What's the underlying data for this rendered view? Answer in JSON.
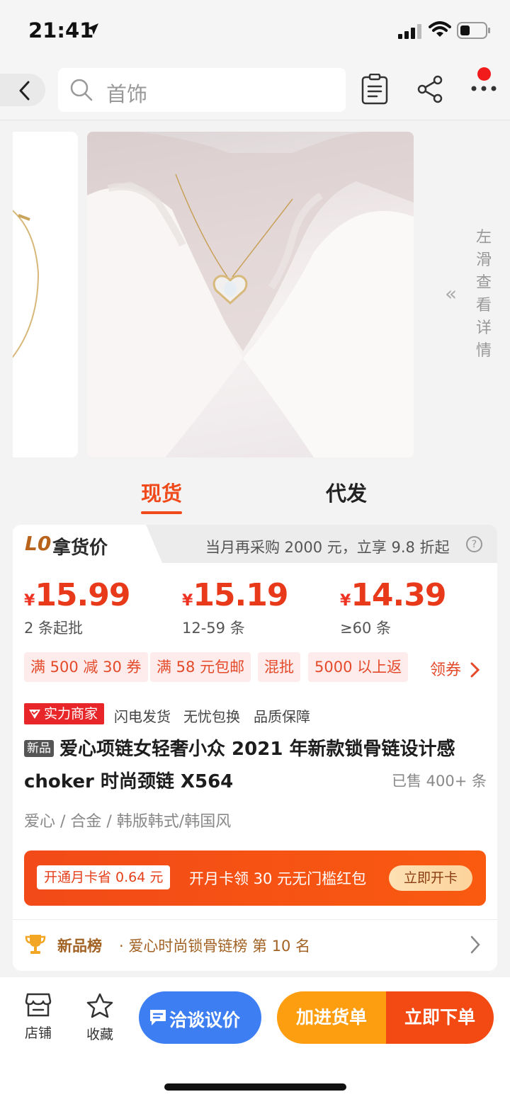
{
  "status_bar": {
    "time": "21:41"
  },
  "nav": {
    "search_placeholder": "首饰"
  },
  "gallery": {
    "slide_hint": "左滑查看详情"
  },
  "tabs": [
    {
      "label": "现货",
      "active": true
    },
    {
      "label": "代发",
      "active": false
    }
  ],
  "price_card": {
    "level_badge": "L0",
    "level_label": "拿货价",
    "promo_text": "当月再采购 2000 元，立享 9.8 折起",
    "tiers": [
      {
        "currency": "¥",
        "price": "15.99",
        "qty": "2 条起批"
      },
      {
        "currency": "¥",
        "price": "15.19",
        "qty": "12-59 条"
      },
      {
        "currency": "¥",
        "price": "14.39",
        "qty": "≥60 条"
      }
    ],
    "chips": [
      "满 500 减 30 券",
      "满 58 元包邮",
      "混批",
      "5000 以上返"
    ],
    "coupon_link": "领券"
  },
  "merchant": {
    "badge": "实力商家",
    "tags": [
      "闪电发货",
      "无忧包换",
      "品质保障"
    ]
  },
  "product": {
    "new_tag": "新品",
    "title": "爱心项链女轻奢小众 2021 年新款锁骨链设计感 choker 时尚颈链 X564",
    "sold": "已售 400+ 条",
    "attributes": "爱心 / 合金 / 韩版韩式/韩国风"
  },
  "membership": {
    "save_tag": "开通月卡省 0.64 元",
    "offer": "开月卡领 30 元无门槛红包",
    "cta": "立即开卡"
  },
  "ranking": {
    "label": "新品榜",
    "detail": "· 爱心时尚锁骨链榜  第 10 名"
  },
  "bottom_bar": {
    "store_label": "店铺",
    "favorite_label": "收藏",
    "chat_label": "洽谈议价",
    "cart_label": "加进货单",
    "buy_label": "立即下单"
  },
  "colors": {
    "accent": "#f04a1a",
    "chat_blue": "#3d7ff3",
    "cart_orange": "#fd9d10",
    "buy_red": "#f34a13"
  }
}
